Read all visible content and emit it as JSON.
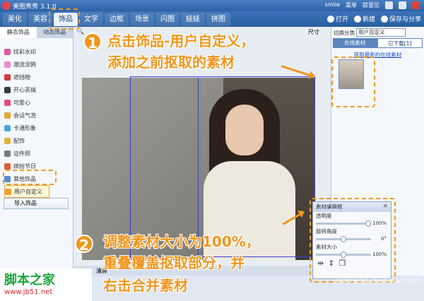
{
  "window": {
    "title": "美图秀秀 3.1.0",
    "user": "smile",
    "menu_label": "菜单",
    "feedback_label": "提意见"
  },
  "tabs": [
    "美化",
    "美容",
    "饰品",
    "文字",
    "边框",
    "场景",
    "闪图",
    "娃娃",
    "拼图"
  ],
  "toolbar": {
    "open": "打开",
    "new": "新建",
    "save_share": "保存与分享"
  },
  "left_panel": {
    "subtabs": [
      "静态饰品",
      "动态饰品"
    ],
    "items": [
      {
        "label": "炫彩水印",
        "color": "#e05a9a"
      },
      {
        "label": "潮流涂鸦",
        "color": "#e88bd0"
      },
      {
        "label": "遮挡物",
        "color": "#d33a3a"
      },
      {
        "label": "开心恶搞",
        "color": "#3a3a3a"
      },
      {
        "label": "可爱心",
        "color": "#e84c7a"
      },
      {
        "label": "会话气泡",
        "color": "#e8a73a"
      },
      {
        "label": "卡通形象",
        "color": "#4aa3e0"
      },
      {
        "label": "配饰",
        "color": "#e0b23a"
      },
      {
        "label": "证件照",
        "color": "#7a7a7a"
      },
      {
        "label": "缤纷节日",
        "color": "#e05a3a"
      },
      {
        "label": "其他饰品",
        "color": "#5a8ad3"
      },
      {
        "label": "用户自定义",
        "color": "#f0a030"
      }
    ],
    "import_button": "导入饰品"
  },
  "editor": {
    "size_label": "尺寸",
    "clear_label": "清屏"
  },
  "right_panel": {
    "category_label": "切换分类",
    "category_value": "用户自定义",
    "tabs": [
      "在线素材",
      "已下载[1]"
    ],
    "link": "获取最新的在线素材"
  },
  "material_box": {
    "title": "素材编辑框",
    "opacity_label": "透明度",
    "opacity_value": "100%",
    "opacity_level": 1.0,
    "rotate_label": "旋转角度",
    "rotate_value": "0°",
    "rotate_level": 0.5,
    "size_label": "素材大小",
    "size_value": "100%",
    "size_level": 0.5
  },
  "annotations": {
    "step1_num": "1",
    "step1_line1": "点击饰品-用户自定义，",
    "step1_line2": "添加之前抠取的素材",
    "step2_num": "2",
    "step2_line1": "调整素材大小为100%，",
    "step2_line2": "重叠覆盖抠取部分，并",
    "step2_line3": "右击合并素材"
  },
  "watermarks": {
    "left_big": "脚本之家",
    "left_small": "www.jb51.net",
    "right": "jiaocheng.chazidian.com"
  }
}
